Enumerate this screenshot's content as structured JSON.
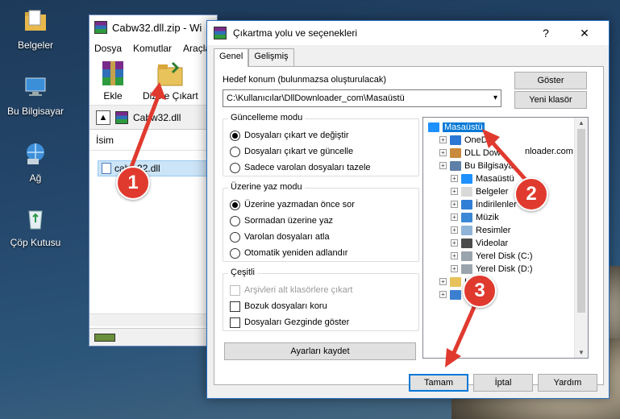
{
  "desktop": {
    "icons": [
      {
        "label": "Belgeler"
      },
      {
        "label": "Bu Bilgisayar"
      },
      {
        "label": "Ağ"
      },
      {
        "label": "Çöp Kutusu"
      }
    ]
  },
  "winrar": {
    "title": "Cabw32.dll.zip - Wi",
    "menu": [
      "Dosya",
      "Komutlar",
      "Araçla"
    ],
    "toolbar": {
      "add_label": "Ekle",
      "extract_label": "Dizine Çıkart"
    },
    "path": "Cabw32.dll",
    "column_name": "İsim",
    "file_row": "cabw32.dll"
  },
  "dialog": {
    "title": "Çıkartma yolu ve seçenekleri",
    "help_glyph": "?",
    "close_glyph": "✕",
    "tabs": [
      "Genel",
      "Gelişmiş"
    ],
    "destination_label": "Hedef konum (bulunmazsa oluşturulacak)",
    "destination_value": "C:\\Kullanıcılar\\DllDownloader_com\\Masaüstü",
    "show_button": "Göster",
    "new_folder_button": "Yeni klasör",
    "update_mode": {
      "title": "Güncelleme modu",
      "options": [
        "Dosyaları çıkart ve değiştir",
        "Dosyaları çıkart ve güncelle",
        "Sadece varolan dosyaları tazele"
      ],
      "selected": 0
    },
    "overwrite_mode": {
      "title": "Üzerine yaz modu",
      "options": [
        "Üzerine yazmadan önce sor",
        "Sormadan üzerine yaz",
        "Varolan dosyaları atla",
        "Otomatik yeniden adlandır"
      ],
      "selected": 0
    },
    "misc": {
      "title": "Çeşitli",
      "options": [
        "Arşivleri alt klasörlere çıkart",
        "Bozuk dosyaları koru",
        "Dosyaları Gezginde göster"
      ]
    },
    "save_settings_button": "Ayarları kaydet",
    "tree": [
      {
        "label": "Masaüstü",
        "level": 0,
        "selected": true,
        "color": "#1e90ff"
      },
      {
        "label": "OneD",
        "level": 1,
        "color": "#2b78d4"
      },
      {
        "label": "DLL Dow",
        "level": 1,
        "color": "#c98a3c"
      },
      {
        "label": "Bu Bilgisaya",
        "level": 1,
        "color": "#5e7fa8"
      },
      {
        "label": "Masaüstü",
        "level": 2,
        "color": "#1e90ff"
      },
      {
        "label": "Belgeler",
        "level": 2,
        "color": "#d9d9d9"
      },
      {
        "label": "İndirilenler",
        "level": 2,
        "color": "#2f7fd6"
      },
      {
        "label": "Müzik",
        "level": 2,
        "color": "#3a88d6"
      },
      {
        "label": "Resimler",
        "level": 2,
        "color": "#8fb4d8"
      },
      {
        "label": "Videolar",
        "level": 2,
        "color": "#4b4b4b"
      },
      {
        "label": "Yerel Disk (C:)",
        "level": 2,
        "color": "#9aa4ad"
      },
      {
        "label": "Yerel Disk (D:)",
        "level": 2,
        "color": "#9aa4ad"
      },
      {
        "label": "Kit",
        "level": 1,
        "color": "#e8c25b"
      },
      {
        "label": "Ağ",
        "level": 1,
        "color": "#3b7fd0"
      }
    ],
    "tree_extra": "nloader.com",
    "ok_button": "Tamam",
    "cancel_button": "İptal",
    "help_button": "Yardım"
  },
  "steps": [
    "1",
    "2",
    "3"
  ],
  "colors": {
    "badge": "#e03a2f",
    "accent": "#0078d7"
  }
}
